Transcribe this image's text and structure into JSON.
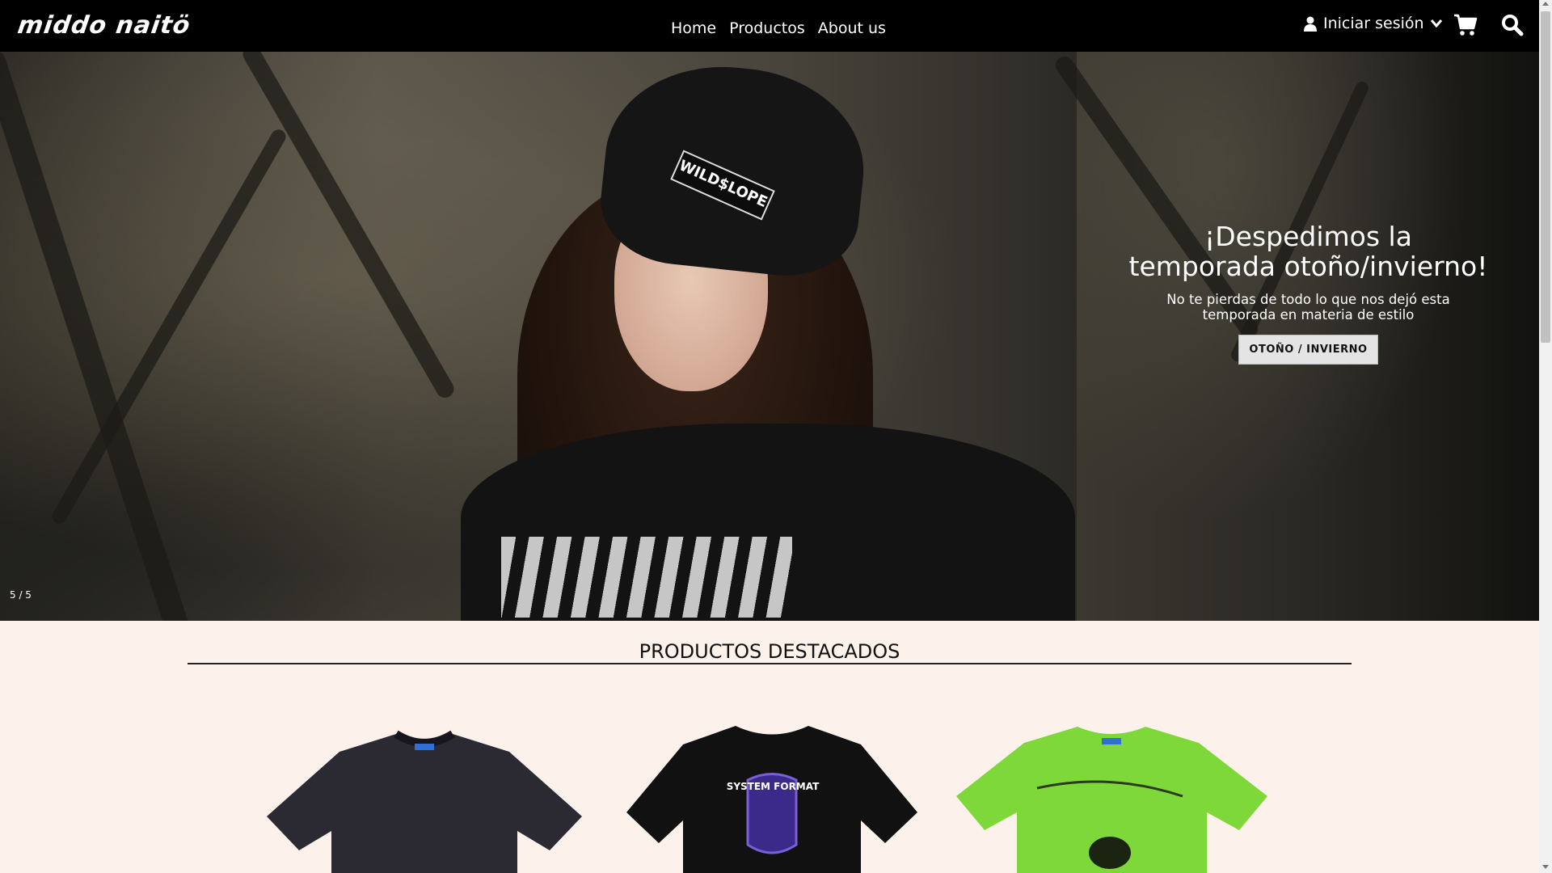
{
  "header": {
    "logo_text": "middo naitö",
    "nav": [
      "Home",
      "Productos",
      "About us"
    ],
    "account_label": "Iniciar sesión",
    "icons": {
      "user": "user-icon",
      "chevron": "chevron-down-icon",
      "cart": "cart-icon",
      "search": "search-icon"
    }
  },
  "hero": {
    "beanie_text": "WILD$LOPE",
    "title": "¡Despedimos la temporada otoño/invierno!",
    "subtitle": "No te pierdas de todo lo que nos dejó esta temporada en materia de estilo",
    "button_label": "OTOÑO / INVIERNO",
    "slide_counter": "5 / 5"
  },
  "featured": {
    "title": "PRODUCTOS DESTACADOS",
    "products": [
      {
        "name": "product-washed-black-tee",
        "color": "#2b2a33"
      },
      {
        "name": "product-system-format-tee",
        "color": "#111111",
        "print_text": "SYSTEM FORMAT"
      },
      {
        "name": "product-green-tee",
        "color": "#7ed83a"
      }
    ]
  },
  "colors": {
    "header_bg": "#000000",
    "page_bg": "#fdf1ec",
    "button_bg": "#e4e4e4"
  }
}
